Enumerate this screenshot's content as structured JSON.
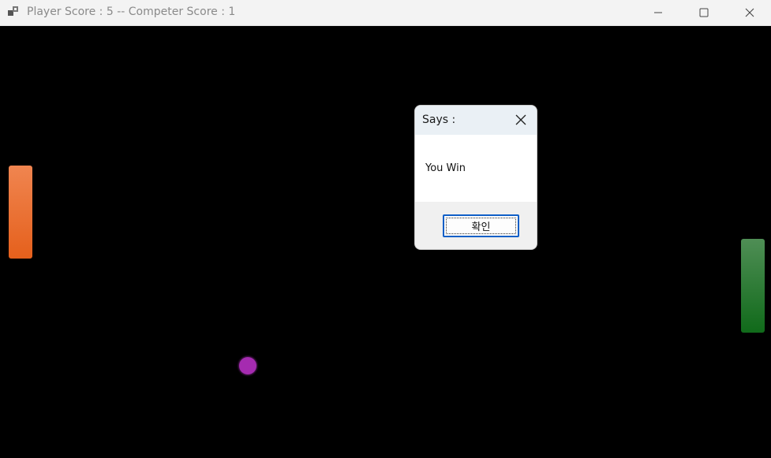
{
  "window": {
    "title": "Player Score : 5 -- Competer Score : 1",
    "icon": "app-window-icon",
    "controls": {
      "minimize_icon": "minimize-icon",
      "maximize_icon": "maximize-icon",
      "close_icon": "close-icon"
    }
  },
  "game": {
    "background_color": "#000000",
    "player_paddle_color": "#e5601c",
    "competitor_paddle_color": "#106a1a",
    "ball_color": "#a52bb0"
  },
  "dialog": {
    "title": "Says :",
    "message": "You Win",
    "ok_label": "확인",
    "close_icon": "close-icon"
  }
}
